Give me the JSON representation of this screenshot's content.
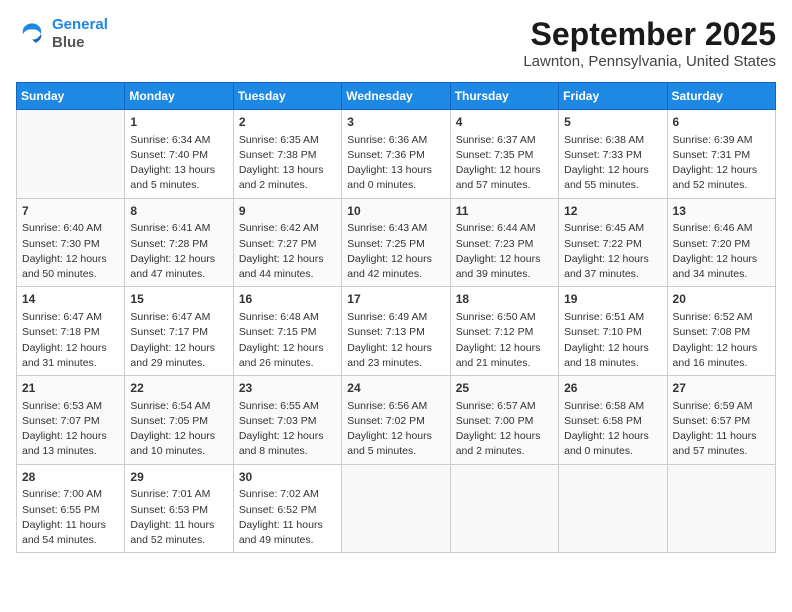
{
  "header": {
    "logo_line1": "General",
    "logo_line2": "Blue",
    "month": "September 2025",
    "location": "Lawnton, Pennsylvania, United States"
  },
  "weekdays": [
    "Sunday",
    "Monday",
    "Tuesday",
    "Wednesday",
    "Thursday",
    "Friday",
    "Saturday"
  ],
  "weeks": [
    [
      {
        "day": "",
        "content": ""
      },
      {
        "day": "1",
        "content": "Sunrise: 6:34 AM\nSunset: 7:40 PM\nDaylight: 13 hours\nand 5 minutes."
      },
      {
        "day": "2",
        "content": "Sunrise: 6:35 AM\nSunset: 7:38 PM\nDaylight: 13 hours\nand 2 minutes."
      },
      {
        "day": "3",
        "content": "Sunrise: 6:36 AM\nSunset: 7:36 PM\nDaylight: 13 hours\nand 0 minutes."
      },
      {
        "day": "4",
        "content": "Sunrise: 6:37 AM\nSunset: 7:35 PM\nDaylight: 12 hours\nand 57 minutes."
      },
      {
        "day": "5",
        "content": "Sunrise: 6:38 AM\nSunset: 7:33 PM\nDaylight: 12 hours\nand 55 minutes."
      },
      {
        "day": "6",
        "content": "Sunrise: 6:39 AM\nSunset: 7:31 PM\nDaylight: 12 hours\nand 52 minutes."
      }
    ],
    [
      {
        "day": "7",
        "content": "Sunrise: 6:40 AM\nSunset: 7:30 PM\nDaylight: 12 hours\nand 50 minutes."
      },
      {
        "day": "8",
        "content": "Sunrise: 6:41 AM\nSunset: 7:28 PM\nDaylight: 12 hours\nand 47 minutes."
      },
      {
        "day": "9",
        "content": "Sunrise: 6:42 AM\nSunset: 7:27 PM\nDaylight: 12 hours\nand 44 minutes."
      },
      {
        "day": "10",
        "content": "Sunrise: 6:43 AM\nSunset: 7:25 PM\nDaylight: 12 hours\nand 42 minutes."
      },
      {
        "day": "11",
        "content": "Sunrise: 6:44 AM\nSunset: 7:23 PM\nDaylight: 12 hours\nand 39 minutes."
      },
      {
        "day": "12",
        "content": "Sunrise: 6:45 AM\nSunset: 7:22 PM\nDaylight: 12 hours\nand 37 minutes."
      },
      {
        "day": "13",
        "content": "Sunrise: 6:46 AM\nSunset: 7:20 PM\nDaylight: 12 hours\nand 34 minutes."
      }
    ],
    [
      {
        "day": "14",
        "content": "Sunrise: 6:47 AM\nSunset: 7:18 PM\nDaylight: 12 hours\nand 31 minutes."
      },
      {
        "day": "15",
        "content": "Sunrise: 6:47 AM\nSunset: 7:17 PM\nDaylight: 12 hours\nand 29 minutes."
      },
      {
        "day": "16",
        "content": "Sunrise: 6:48 AM\nSunset: 7:15 PM\nDaylight: 12 hours\nand 26 minutes."
      },
      {
        "day": "17",
        "content": "Sunrise: 6:49 AM\nSunset: 7:13 PM\nDaylight: 12 hours\nand 23 minutes."
      },
      {
        "day": "18",
        "content": "Sunrise: 6:50 AM\nSunset: 7:12 PM\nDaylight: 12 hours\nand 21 minutes."
      },
      {
        "day": "19",
        "content": "Sunrise: 6:51 AM\nSunset: 7:10 PM\nDaylight: 12 hours\nand 18 minutes."
      },
      {
        "day": "20",
        "content": "Sunrise: 6:52 AM\nSunset: 7:08 PM\nDaylight: 12 hours\nand 16 minutes."
      }
    ],
    [
      {
        "day": "21",
        "content": "Sunrise: 6:53 AM\nSunset: 7:07 PM\nDaylight: 12 hours\nand 13 minutes."
      },
      {
        "day": "22",
        "content": "Sunrise: 6:54 AM\nSunset: 7:05 PM\nDaylight: 12 hours\nand 10 minutes."
      },
      {
        "day": "23",
        "content": "Sunrise: 6:55 AM\nSunset: 7:03 PM\nDaylight: 12 hours\nand 8 minutes."
      },
      {
        "day": "24",
        "content": "Sunrise: 6:56 AM\nSunset: 7:02 PM\nDaylight: 12 hours\nand 5 minutes."
      },
      {
        "day": "25",
        "content": "Sunrise: 6:57 AM\nSunset: 7:00 PM\nDaylight: 12 hours\nand 2 minutes."
      },
      {
        "day": "26",
        "content": "Sunrise: 6:58 AM\nSunset: 6:58 PM\nDaylight: 12 hours\nand 0 minutes."
      },
      {
        "day": "27",
        "content": "Sunrise: 6:59 AM\nSunset: 6:57 PM\nDaylight: 11 hours\nand 57 minutes."
      }
    ],
    [
      {
        "day": "28",
        "content": "Sunrise: 7:00 AM\nSunset: 6:55 PM\nDaylight: 11 hours\nand 54 minutes."
      },
      {
        "day": "29",
        "content": "Sunrise: 7:01 AM\nSunset: 6:53 PM\nDaylight: 11 hours\nand 52 minutes."
      },
      {
        "day": "30",
        "content": "Sunrise: 7:02 AM\nSunset: 6:52 PM\nDaylight: 11 hours\nand 49 minutes."
      },
      {
        "day": "",
        "content": ""
      },
      {
        "day": "",
        "content": ""
      },
      {
        "day": "",
        "content": ""
      },
      {
        "day": "",
        "content": ""
      }
    ]
  ]
}
